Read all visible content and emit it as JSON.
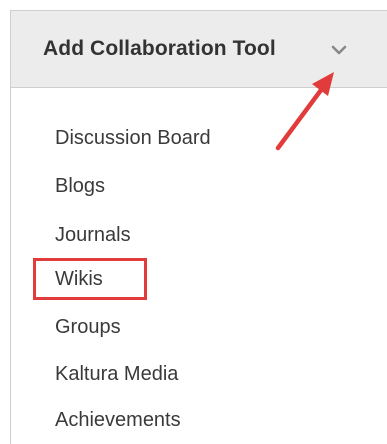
{
  "dropdown": {
    "button_label": "Add Collaboration Tool",
    "icon": "chevron-down-icon",
    "items": [
      {
        "label": "Discussion Board"
      },
      {
        "label": "Blogs"
      },
      {
        "label": "Journals"
      },
      {
        "label": "Wikis",
        "highlighted": true
      },
      {
        "label": "Groups"
      },
      {
        "label": "Kaltura Media"
      },
      {
        "label": "Achievements"
      }
    ]
  },
  "annotation": {
    "highlight_color": "#e23b3b",
    "arrow_color": "#e23b3b",
    "arrow_target": "chevron-down-icon",
    "highlight_target": "Wikis"
  },
  "colors": {
    "button_bg": "#ececec",
    "text": "#333333",
    "border": "#cfcfcf"
  }
}
